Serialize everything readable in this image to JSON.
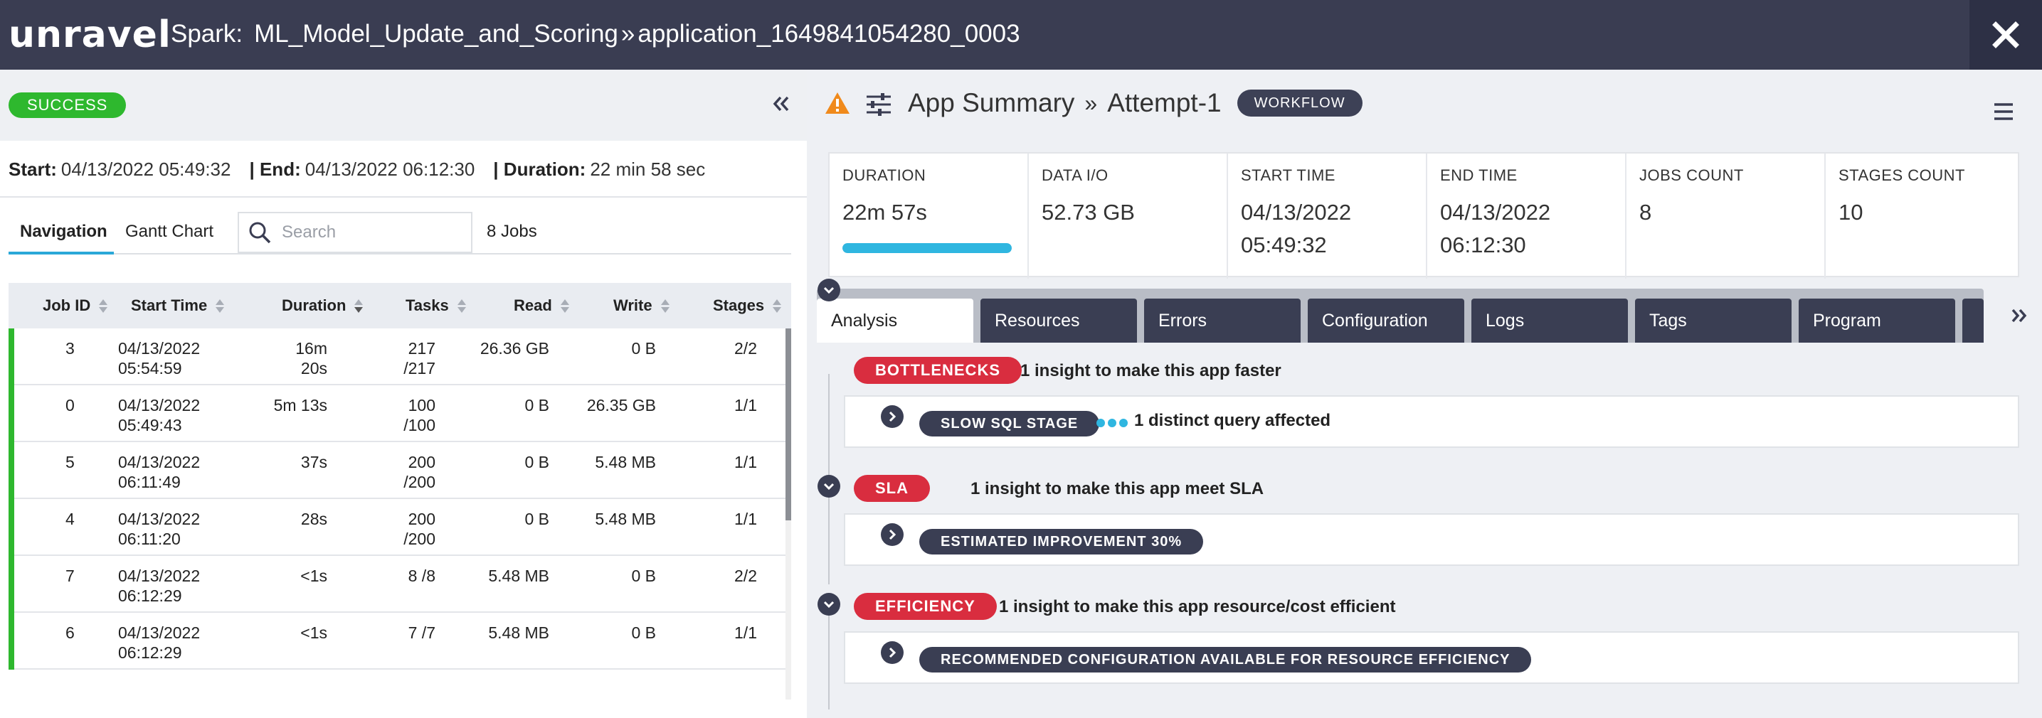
{
  "header": {
    "logo": "unravel",
    "crumb_prefix": "Spark:",
    "app_name": "ML_Model_Update_and_Scoring",
    "separator": "»",
    "application_id": "application_1649841054280_0003"
  },
  "left": {
    "status": "SUCCESS",
    "start_label": "Start:",
    "start_value": "04/13/2022 05:49:32",
    "end_label": "| End:",
    "end_value": "04/13/2022 06:12:30",
    "duration_label": "| Duration:",
    "duration_value": "22 min 58 sec",
    "tabs": [
      "Navigation",
      "Gantt Chart"
    ],
    "search_placeholder": "Search",
    "jobs_count": "8 Jobs",
    "columns": [
      "Job ID",
      "Start Time",
      "Duration",
      "Tasks",
      "Read",
      "Write",
      "Stages"
    ],
    "rows": [
      {
        "id": "3",
        "start1": "04/13/2022",
        "start2": "05:54:59",
        "dur1": "16m",
        "dur2": "20s",
        "tasks1": "217",
        "tasks2": "/217",
        "read": "26.36 GB",
        "write": "0 B",
        "stages": "2/2"
      },
      {
        "id": "0",
        "start1": "04/13/2022",
        "start2": "05:49:43",
        "dur1": "5m 13s",
        "dur2": "",
        "tasks1": "100",
        "tasks2": "/100",
        "read": "0 B",
        "write": "26.35 GB",
        "stages": "1/1"
      },
      {
        "id": "5",
        "start1": "04/13/2022",
        "start2": "06:11:49",
        "dur1": "37s",
        "dur2": "",
        "tasks1": "200",
        "tasks2": "/200",
        "read": "0 B",
        "write": "5.48 MB",
        "stages": "1/1"
      },
      {
        "id": "4",
        "start1": "04/13/2022",
        "start2": "06:11:20",
        "dur1": "28s",
        "dur2": "",
        "tasks1": "200",
        "tasks2": "/200",
        "read": "0 B",
        "write": "5.48 MB",
        "stages": "1/1"
      },
      {
        "id": "7",
        "start1": "04/13/2022",
        "start2": "06:12:29",
        "dur1": "<1s",
        "dur2": "",
        "tasks1": "8 /8",
        "tasks2": "",
        "read": "5.48 MB",
        "write": "0 B",
        "stages": "2/2"
      },
      {
        "id": "6",
        "start1": "04/13/2022",
        "start2": "06:12:29",
        "dur1": "<1s",
        "dur2": "",
        "tasks1": "7 /7",
        "tasks2": "",
        "read": "5.48 MB",
        "write": "0 B",
        "stages": "1/1"
      }
    ]
  },
  "right": {
    "title": "App Summary",
    "separator": "»",
    "attempt": "Attempt-1",
    "badge": "WORKFLOW",
    "stats": [
      {
        "label": "DURATION",
        "value": "22m 57s",
        "progress": 1.0
      },
      {
        "label": "DATA I/O",
        "value": "52.73 GB"
      },
      {
        "label": "START TIME",
        "value1": "04/13/2022",
        "value2": "05:49:32"
      },
      {
        "label": "END TIME",
        "value1": "04/13/2022",
        "value2": "06:12:30"
      },
      {
        "label": "JOBS COUNT",
        "value": "8"
      },
      {
        "label": "STAGES COUNT",
        "value": "10"
      }
    ],
    "tabs": [
      "Analysis",
      "Resources",
      "Errors",
      "Configuration",
      "Logs",
      "Tags",
      "Program"
    ],
    "insights": [
      {
        "tag": "BOTTLENECKS",
        "text": "1 insight to make this app faster",
        "sub_tag": "SLOW SQL STAGE",
        "sub_text": "1 distinct query affected"
      },
      {
        "tag": "SLA",
        "text": "1 insight to make this app meet SLA",
        "sub_tag": "ESTIMATED IMPROVEMENT 30%",
        "sub_text": ""
      },
      {
        "tag": "EFFICIENCY",
        "text": "1 insight to make this app resource/cost efficient",
        "sub_tag": "RECOMMENDED CONFIGURATION AVAILABLE FOR RESOURCE EFFICIENCY",
        "sub_text": ""
      }
    ]
  },
  "colors": {
    "header_bg": "#3a3d52",
    "success": "#2eb82e",
    "accent": "#2fb6e0",
    "danger": "#d92d3f",
    "dark_tag": "#3a3e53",
    "warning": "#f08a1c"
  }
}
